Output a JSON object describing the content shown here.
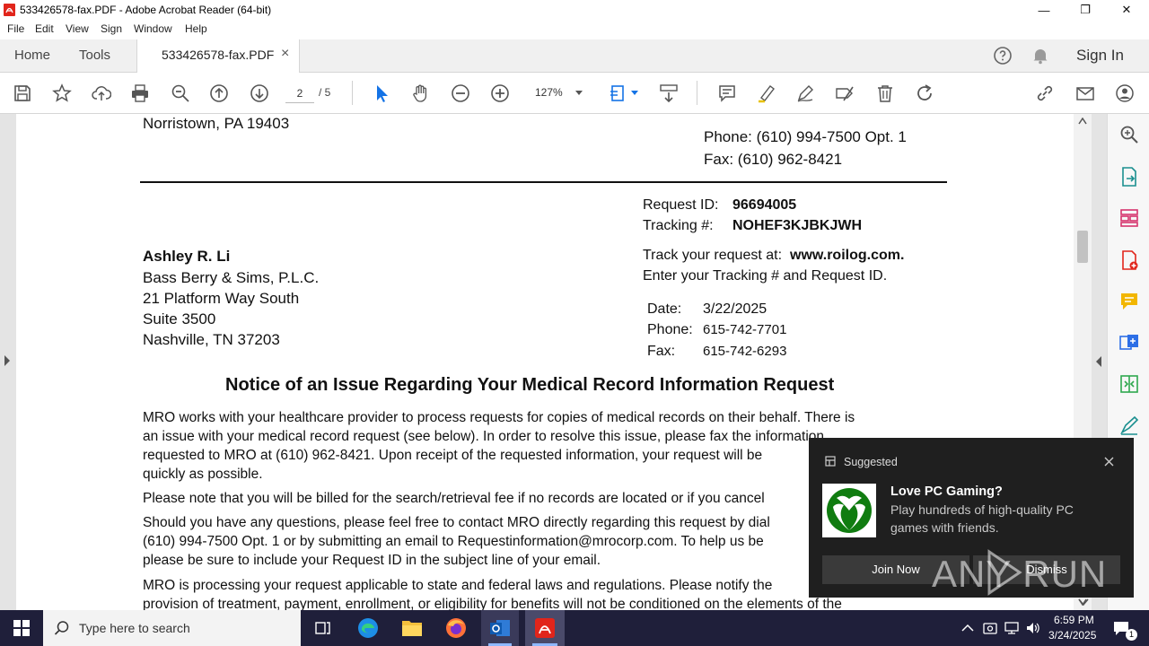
{
  "window": {
    "title": "533426578-fax.PDF - Adobe Acrobat Reader (64-bit)",
    "minimize": "—",
    "maximize": "❐",
    "close": "✕"
  },
  "menu": [
    "File",
    "Edit",
    "View",
    "Sign",
    "Window",
    "Help"
  ],
  "tabs": {
    "home": "Home",
    "tools": "Tools",
    "document": "533426578-fax.PDF",
    "close": "×",
    "sign_in": "Sign In"
  },
  "toolbar": {
    "page_current": "2",
    "page_total": "/ 5",
    "zoom": "127%"
  },
  "document": {
    "city_line": "Norristown, PA 19403",
    "phone_opt": "Phone: (610) 994-7500 Opt. 1",
    "fax_line": "Fax: (610) 962-8421",
    "request_id_label": "Request ID:",
    "request_id": "96694005",
    "tracking_label": "Tracking #:",
    "tracking": "NOHEF3KJBKJWH",
    "track_prefix": "Track your request at:",
    "track_url": "www.roilog.com.",
    "track_instr": "Enter your Tracking # and Request ID.",
    "recipient_name": "Ashley R. Li",
    "recipient_firm": "Bass Berry & Sims, P.L.C.",
    "recipient_addr1": "21 Platform Way South",
    "recipient_addr2": "Suite 3500",
    "recipient_addr3": "Nashville, TN  37203",
    "date_label": "Date:",
    "date_val": "3/22/2025",
    "phone_label": "Phone:",
    "phone_val": "615-742-7701",
    "fax_label": "Fax:",
    "fax_val": "615-742-6293",
    "heading": "Notice of an Issue Regarding Your Medical Record Information Request",
    "p1_l1": "MRO works with your healthcare provider to process requests for copies of medical records on their behalf. There is",
    "p1_l2": "an issue with your medical record request (see below). In order to resolve this issue, please fax the information",
    "p1_l3": "requested to MRO at (610) 962-8421. Upon receipt of the requested information, your request will be",
    "p1_l4": "quickly as possible.",
    "p2_l1": "Please note that you will be billed for the search/retrieval fee if no records are located or if you cancel",
    "p3_l1": "Should you have any questions, please feel free to contact MRO directly regarding this request by dial",
    "p3_l2": "(610) 994-7500 Opt. 1 or by submitting an email to Requestinformation@mrocorp.com. To help us be",
    "p3_l3": "please be sure to include your Request ID in the subject line of your email.",
    "p4_l1": "MRO is processing your request applicable to state and federal laws and regulations. Please notify the",
    "p4_l2": "provision of treatment, payment, enrollment, or eligibility for benefits will not be conditioned on the elements of the"
  },
  "toast": {
    "header": "Suggested",
    "title": "Love PC Gaming?",
    "body_l1": "Play hundreds of high-quality PC",
    "body_l2": "games with friends.",
    "join": "Join Now",
    "dismiss": "Dismiss",
    "watermark": "ANY RUN"
  },
  "taskbar": {
    "search_placeholder": "Type here to search",
    "time": "6:59 PM",
    "date": "3/24/2025",
    "notif_count": "1"
  },
  "colors": {
    "accent_blue": "#1473e6",
    "acrobat_red": "#e1251b",
    "xbox_green": "#107c10"
  }
}
